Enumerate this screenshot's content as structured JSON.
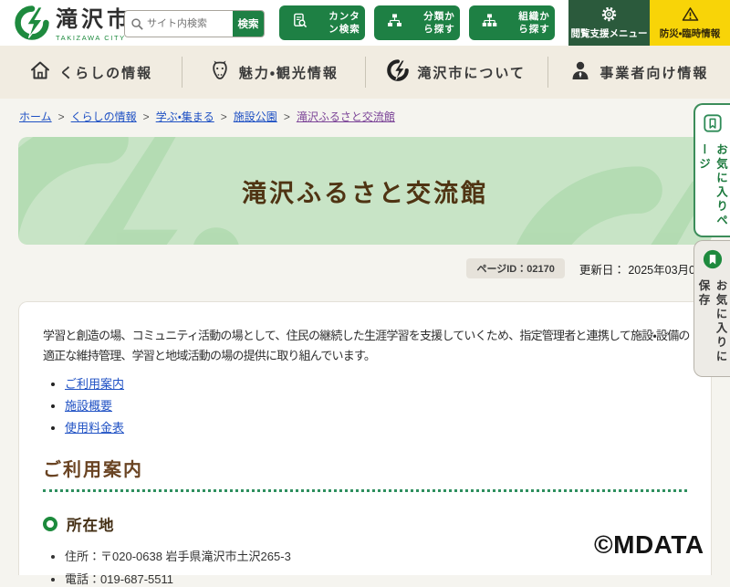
{
  "header": {
    "logo": {
      "city_name": "滝沢市",
      "city_name_en": "TAKIZAWA CITY"
    },
    "search": {
      "placeholder": "サイト内検索",
      "button_label": "検索"
    },
    "quick_buttons": [
      {
        "label": "カンタン検索",
        "icon": "document-search-icon"
      },
      {
        "label": "分類から探す",
        "icon": "category-tree-icon"
      },
      {
        "label": "組織から探す",
        "icon": "org-chart-icon"
      }
    ],
    "support_menu": {
      "label": "閲覧支援メニュー",
      "icon": "gear-icon"
    },
    "emergency": {
      "label": "防災・臨時情報",
      "icon": "warning-icon"
    }
  },
  "nav": {
    "items": [
      {
        "label": "くらしの情報",
        "icon": "house-icon"
      },
      {
        "label": "魅力・観光情報",
        "icon": "horse-icon"
      },
      {
        "label": "滝沢市について",
        "icon": "city-logo-icon"
      },
      {
        "label": "事業者向け情報",
        "icon": "business-person-icon"
      }
    ]
  },
  "breadcrumb": {
    "separator": ">",
    "items": [
      "ホーム",
      "くらしの情報",
      "学ぶ・集まる",
      "施設公園",
      "滝沢ふるさと交流館"
    ]
  },
  "page": {
    "title": "滝沢ふるさと交流館",
    "page_id_label": "ページID：02170",
    "updated_label": "更新日：",
    "updated_value": "2025年03月0"
  },
  "side_tabs": [
    {
      "label": "お気に入りページ",
      "icon": "bookmark-outline-icon"
    },
    {
      "label": "お気に入りに保存",
      "icon": "bookmark-filled-icon"
    }
  ],
  "content": {
    "intro": "学習と創造の場、コミュニティ活動の場として、住民の継続した生涯学習を支援していくため、指定管理者と連携して施設・設備の適正な維持管理、学習と地域活動の場の提供に取り組んでいます。",
    "anchor_links": [
      "ご利用案内",
      "施設概要",
      "使用料金表"
    ],
    "section_title": "ご利用案内",
    "subsection_title": "所在地",
    "details": [
      "住所：〒020-0638 岩手県滝沢市土沢265-3",
      "電話：019-687-5511"
    ]
  },
  "watermark": "©MDATA",
  "colors": {
    "brand_green": "#1e8044",
    "dark_green_panel": "#2b5a3c",
    "emergency_yellow": "#f8d408",
    "banner_green": "#c8e4c6",
    "heading_brown": "#6a4423",
    "link_blue": "#1f51c4",
    "visited_purple": "#7b4397",
    "dotted_line_green": "#2e8f5e"
  }
}
